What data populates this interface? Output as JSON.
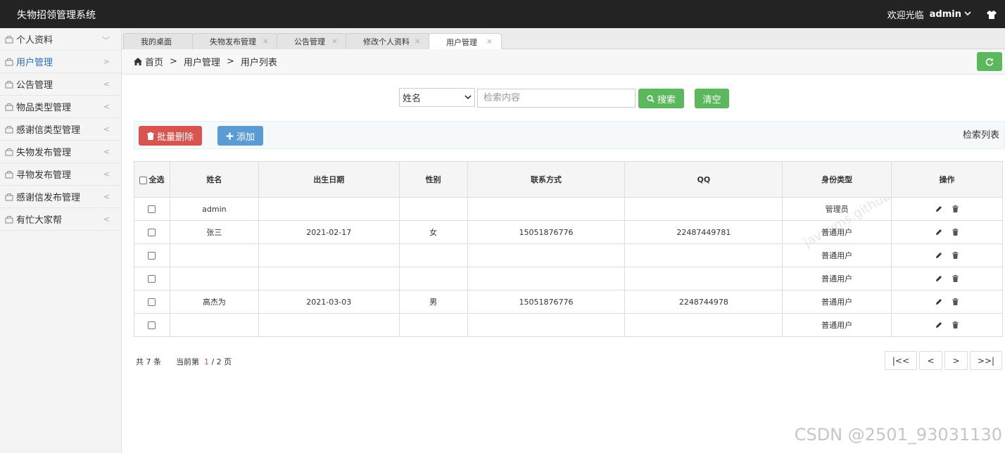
{
  "app_title": "失物招领管理系统",
  "header": {
    "welcome": "欢迎光临",
    "user": "admin"
  },
  "sidebar": {
    "items": [
      {
        "label": "个人资料",
        "arrow": "﹀"
      },
      {
        "label": "用户管理",
        "arrow": ">"
      },
      {
        "label": "公告管理",
        "arrow": "<"
      },
      {
        "label": "物品类型管理",
        "arrow": "<"
      },
      {
        "label": "感谢信类型管理",
        "arrow": "<"
      },
      {
        "label": "失物发布管理",
        "arrow": "<"
      },
      {
        "label": "寻物发布管理",
        "arrow": "<"
      },
      {
        "label": "感谢信发布管理",
        "arrow": "<"
      },
      {
        "label": "有忙大家帮",
        "arrow": "<"
      }
    ]
  },
  "tabs": [
    {
      "label": "我的桌面"
    },
    {
      "label": "失物发布管理"
    },
    {
      "label": "公告管理"
    },
    {
      "label": "修改个人资料"
    },
    {
      "label": "用户管理"
    }
  ],
  "breadcrumb": {
    "home": "首页",
    "sep": ">",
    "level1": "用户管理",
    "level2": "用户列表"
  },
  "search": {
    "field": "姓名",
    "placeholder": "检索内容",
    "search_label": "搜索",
    "clear_label": "清空"
  },
  "toolbar": {
    "batch_delete_label": "批量删除",
    "add_label": "添加",
    "list_label": "检索列表"
  },
  "table": {
    "select_all": "全选",
    "columns": [
      "姓名",
      "出生日期",
      "性别",
      "联系方式",
      "QQ",
      "身份类型",
      "操作"
    ],
    "rows": [
      {
        "name": "admin",
        "birth": "",
        "gender": "",
        "phone": "",
        "qq": "",
        "type": "管理员"
      },
      {
        "name": "张三",
        "birth": "2021-02-17",
        "gender": "女",
        "phone": "15051876776",
        "qq": "22487449781",
        "type": "普通用户"
      },
      {
        "name": "",
        "birth": "",
        "gender": "",
        "phone": "",
        "qq": "",
        "type": "普通用户"
      },
      {
        "name": "",
        "birth": "",
        "gender": "",
        "phone": "",
        "qq": "",
        "type": "普通用户"
      },
      {
        "name": "高杰为",
        "birth": "2021-03-03",
        "gender": "男",
        "phone": "15051876776",
        "qq": "2248744978",
        "type": "普通用户"
      },
      {
        "name": "",
        "birth": "",
        "gender": "",
        "phone": "",
        "qq": "",
        "type": "普通用户"
      }
    ]
  },
  "pagination": {
    "total_prefix": "共",
    "total": "7",
    "total_suffix": "条",
    "current_prefix": "当前第",
    "current": "1",
    "total_pages": "/ 2 页",
    "first": "|<<",
    "prev": "<",
    "next": ">",
    "last": ">>|"
  },
  "watermark": "CSDN @2501_93031130",
  "watermark_diag": "javayms.github.io",
  "colors": {
    "topbar": "#232323",
    "green": "#5cb85c",
    "red": "#d9534f",
    "blue": "#5b9bd5",
    "active_link": "#2a6fb5"
  }
}
